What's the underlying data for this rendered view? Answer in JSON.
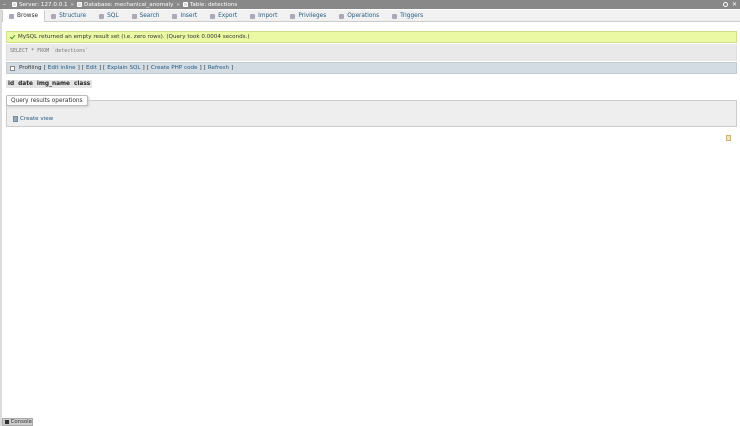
{
  "breadcrumb": {
    "server": "Server: 127.0.0.1",
    "database": "Database: mechanical_anomaly",
    "table": "Table: detections",
    "separator": "»"
  },
  "tabs": [
    {
      "label": "Browse",
      "icon": "table-icon",
      "active": true
    },
    {
      "label": "Structure",
      "icon": "structure-icon"
    },
    {
      "label": "SQL",
      "icon": "sql-icon"
    },
    {
      "label": "Search",
      "icon": "search-icon"
    },
    {
      "label": "Insert",
      "icon": "insert-icon"
    },
    {
      "label": "Export",
      "icon": "export-icon"
    },
    {
      "label": "Import",
      "icon": "import-icon"
    },
    {
      "label": "Privileges",
      "icon": "privileges-icon"
    },
    {
      "label": "Operations",
      "icon": "operations-icon"
    },
    {
      "label": "Triggers",
      "icon": "triggers-icon"
    }
  ],
  "message": {
    "text": "MySQL returned an empty result set (i.e. zero rows). (Query took 0.0004 seconds.)",
    "color": "#ebf8a4"
  },
  "sql": {
    "keyword_select": "SELECT",
    "star": " * ",
    "keyword_from": "FROM",
    "table": "`detections`"
  },
  "query_links": {
    "profiling_label": "Profiling",
    "pipe": "[",
    "edit_inline": "Edit inline",
    "edit": "Edit",
    "explain": "Explain SQL",
    "create_php": "Create PHP code",
    "refresh": "Refresh",
    "sep_open": "[",
    "sep_close": "]",
    "bar": "|"
  },
  "columns": [
    "id",
    "date",
    "img_name",
    "class"
  ],
  "operations": {
    "legend": "Query results operations",
    "create_view": "Create view"
  },
  "console": {
    "label": "Console"
  },
  "colors": {
    "link": "#235a81",
    "topbar": "#888888",
    "linkbar": "#d3dce3"
  }
}
